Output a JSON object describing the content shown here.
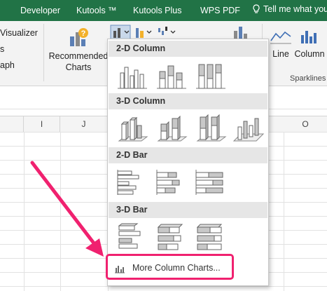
{
  "tabs": {
    "developer": "Developer",
    "kutools": "Kutools ™",
    "kutools_plus": "Kutools Plus",
    "wps_pdf": "WPS PDF",
    "tell_me": "Tell me what you"
  },
  "ribbon": {
    "left_items": [
      "Visualizer",
      "s",
      "aph"
    ],
    "recommended_charts": "Recommended Charts",
    "line": "Line",
    "column": "Column",
    "sparklines_group": "Sparklines"
  },
  "columns": [
    "I",
    "J",
    "O"
  ],
  "dropdown": {
    "sections": {
      "col2d": "2-D Column",
      "col3d": "3-D Column",
      "bar2d": "2-D Bar",
      "bar3d": "3-D Bar"
    },
    "more_column_charts": "More Column Charts..."
  },
  "colors": {
    "ribbon_green": "#217346",
    "highlight_pink": "#f0216f"
  }
}
